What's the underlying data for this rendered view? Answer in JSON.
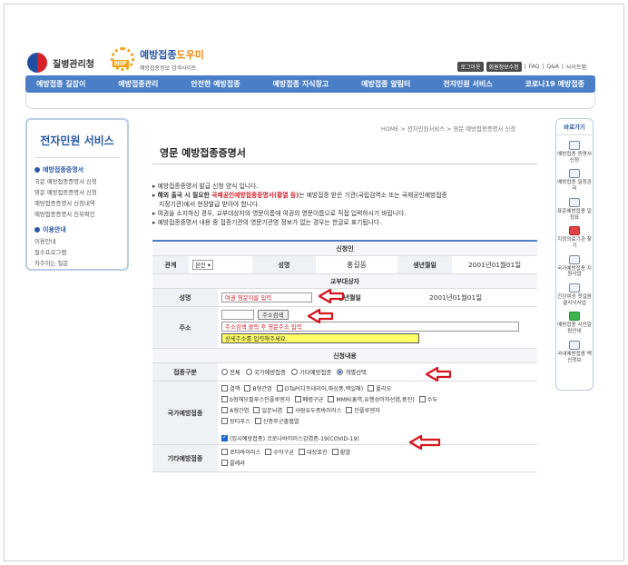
{
  "header": {
    "kdca_logo_text": "질병관리청",
    "vacc_logo_main": "예방접종",
    "vacc_logo_accent": "도우미",
    "vacc_logo_sub": "예방접종정보 검색사이트",
    "nip_badge": "NIP",
    "login_button": "로그아웃",
    "myinfo_button": "회원정보수정",
    "sep1": "|",
    "faq_link": "FAQ",
    "sep2": "|",
    "qa_link": "Q&A",
    "sep3": "|",
    "sitemap_link": "사이트맵"
  },
  "gnb": [
    "예방접종 길잡이",
    "예방접종관리",
    "안전한 예방접종",
    "예방접종 지식창고",
    "예방접종 알림터",
    "전자민원 서비스",
    "코로나19 예방접종"
  ],
  "sidebar": {
    "title": "전자민원 서비스",
    "sections": [
      {
        "label": "예방접종증명서",
        "items": [
          "국문 예방접종증명서 신청",
          "영문 예방접종증명서 신청",
          "예방접종증명서 신청내역",
          "예방접종증명서 진위확인"
        ]
      },
      {
        "label": "이용안내",
        "items": [
          "이용안내",
          "필수프로그램",
          "자주하는 질문"
        ]
      }
    ]
  },
  "quick": {
    "title": "바로가기",
    "items": [
      "예방접종 증명서 신청",
      "예방접종 일정관리",
      "표준예방접종 일정표",
      "지정의료기관 찾기",
      "국가예방접종 지원사업",
      "건강여성 첫걸음 클리닉사업",
      "예방접종 사전알림안내",
      "국내예방접종 백신정보"
    ]
  },
  "breadcrumb": "HOME > 전자민원서비스 > 영문 예방접종증명서 신청",
  "page_title": "영문 예방접종증명서",
  "notes": {
    "n1": "예방접종증명서 발급 신청 양식 입니다.",
    "n2_a": "해외 출국 시 필요한 ",
    "n2_b": "국제공인예방접종증명서(황열 등)",
    "n2_c": "는 예방접종 받은 기관(국립검역소 또는 국제공인예방접종",
    "n2_d": "지정기관)에서 현장발급 받아야 합니다.",
    "n3": "여권을 소지하신 경우, 교부대상자의 영문이름에 여권의 영문이름으로 직접 입력하시기 바랍니다.",
    "n4": "예방접종증명서 내용 중 접종기관의 영문기관명 정보가 없는 경우는 한글로 표기됩니다."
  },
  "form": {
    "applicant_header": "신청인",
    "relation_label": "관계",
    "relation_value": "본인",
    "name_label": "성명",
    "name_value": "홍길동",
    "birth_label": "생년월일",
    "birth_value": "2001년01월01일",
    "recipient_header": "교부대상자",
    "r_name_label": "성명",
    "r_name_placeholder": "여권 영문이름 입력",
    "r_birth_label": "생년월일",
    "r_birth_value": "2001년01월01일",
    "addr_label": "주소",
    "addr_search_button": "주소검색",
    "addr_search_hint": "주소검색 클릭 후 영문주소 입력",
    "addr_detail_placeholder": "상세주소를 입력해주세요.",
    "content_header": "신청내용",
    "type_label": "접종구분",
    "type_options": [
      "전체",
      "국가예방접종",
      "기타예방접종",
      "개별선택"
    ],
    "national_label": "국가예방접종",
    "national_items_r1": [
      "결핵",
      "B형간염",
      "DTaP(디프테리아,파상풍,백일해)",
      "폴리오"
    ],
    "national_items_r2": [
      "b형헤모필루스인플루엔자",
      "폐렴구균",
      "MMR(홍역,유행성이하선염,풍진)",
      "수두"
    ],
    "national_items_r3": [
      "A형간염",
      "일본뇌염",
      "사람유두종바이러스",
      "인플루엔자"
    ],
    "national_items_r4": [
      "장티푸스",
      "신증후군출혈열"
    ],
    "covid_item": "(임시예방접종) 코로나바이러스감염증-19(COVID-19)",
    "other_label": "기타예방접종",
    "other_items_r1": [
      "로타바이러스",
      "수막구균",
      "대상포진",
      "황열"
    ],
    "other_items_r2": [
      "콜레라"
    ]
  },
  "colors": {
    "accent": "#4a7fc8",
    "highlight_red": "#d01f2a",
    "arrow_red": "#d4151c",
    "yellow": "#ffff66"
  }
}
